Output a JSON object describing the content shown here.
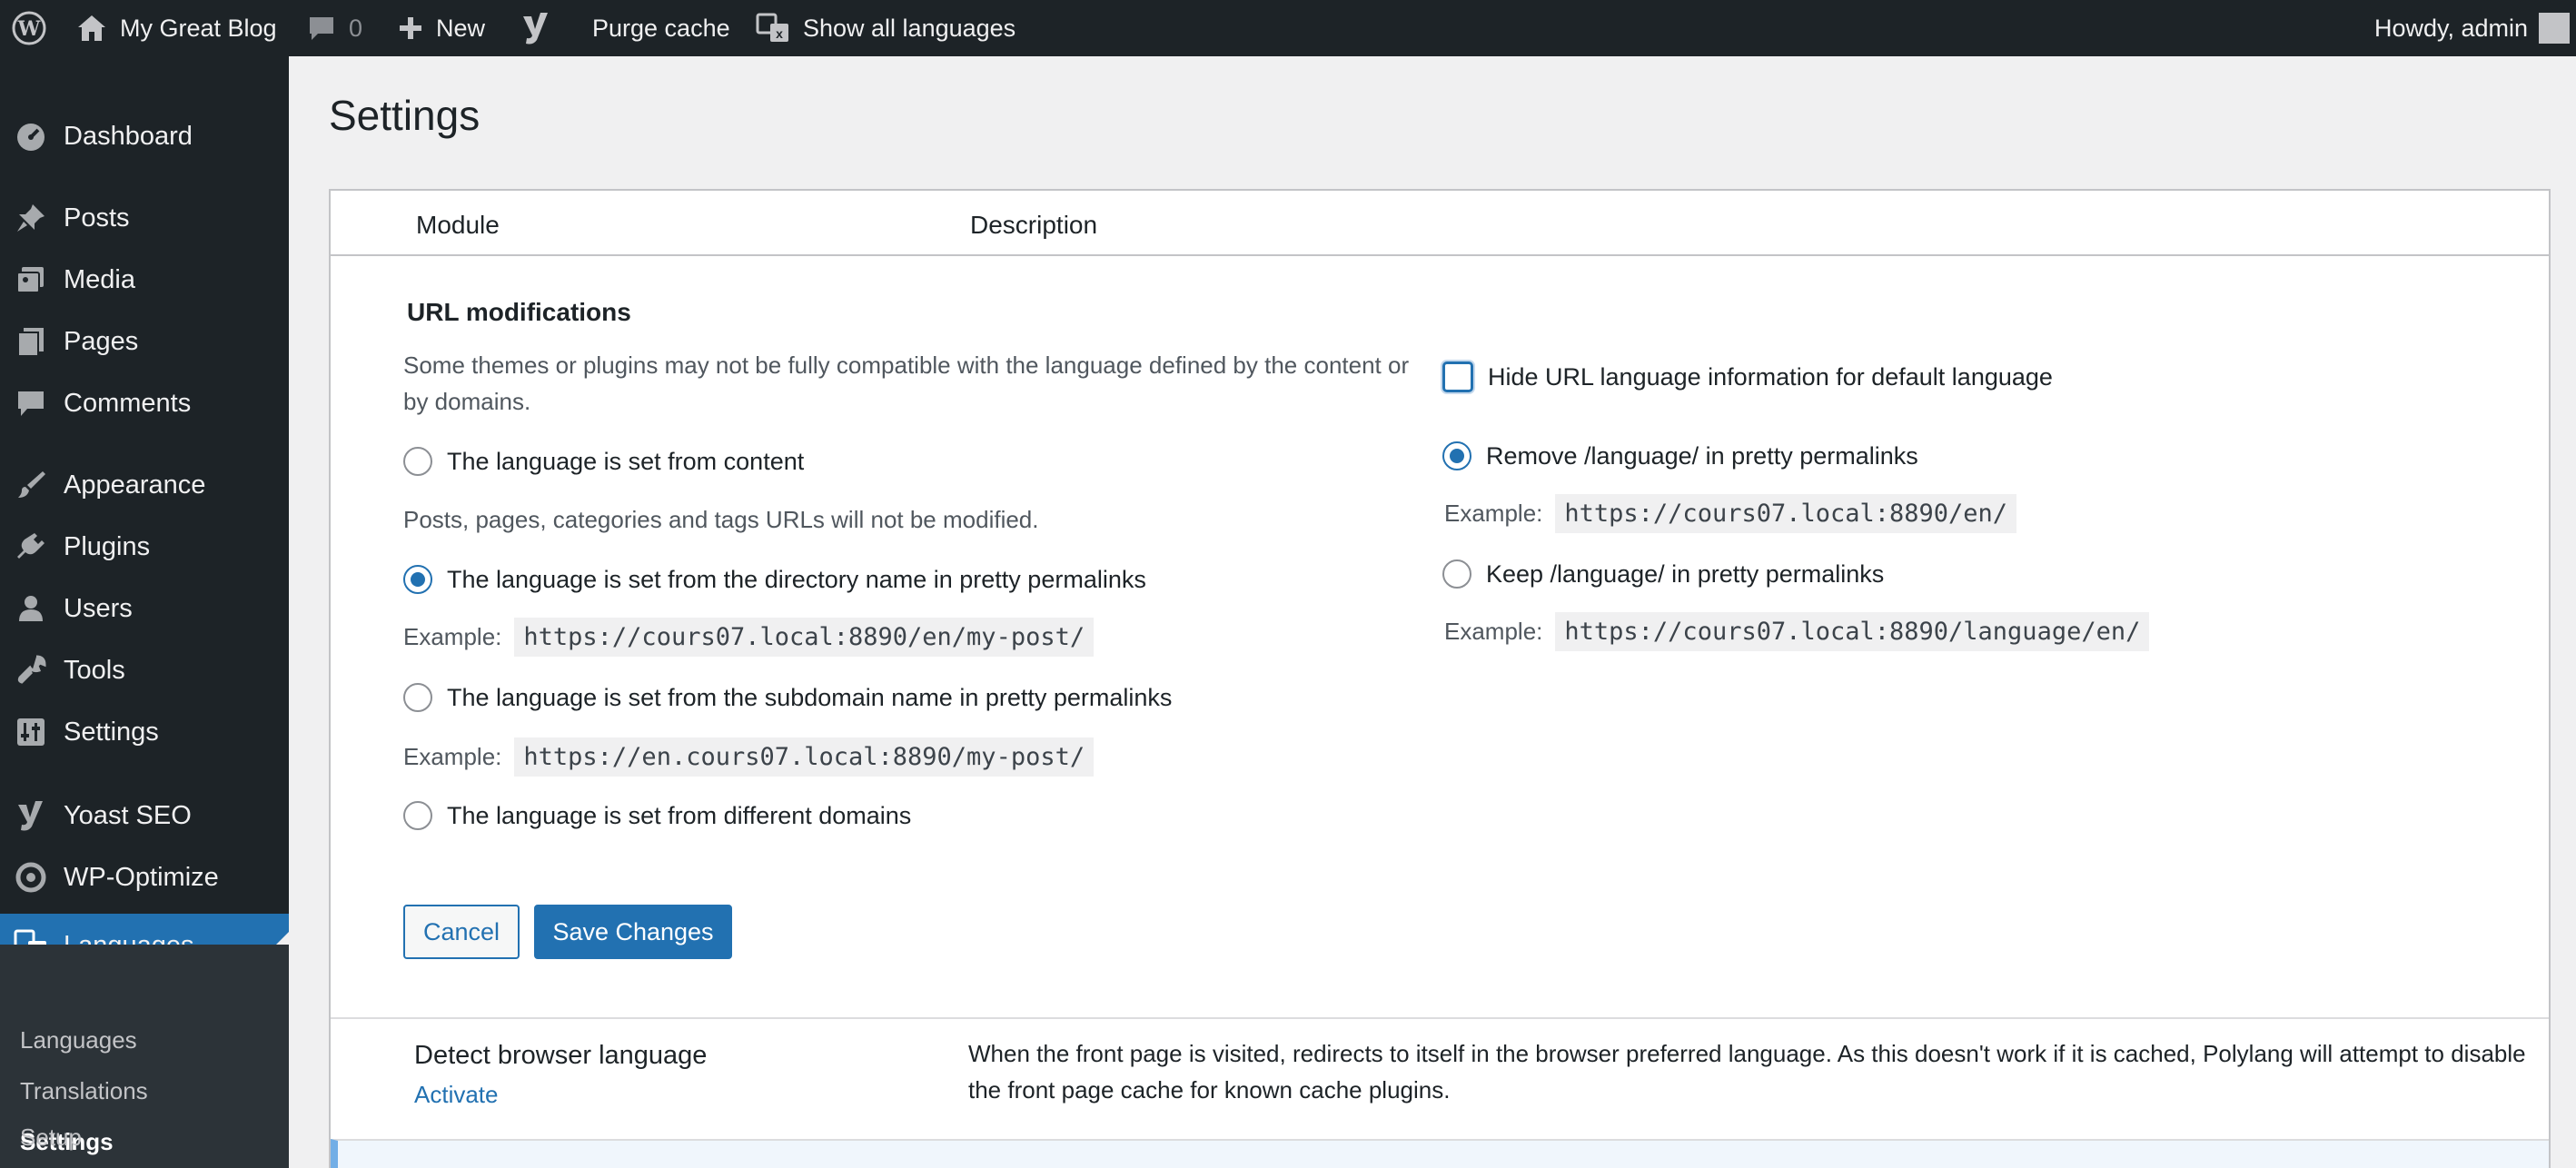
{
  "admin_bar": {
    "site_name": "My Great Blog",
    "comments_count": "0",
    "new_label": "New",
    "purge_cache_label": "Purge cache",
    "show_all_languages_label": "Show all languages",
    "howdy_label": "Howdy, admin"
  },
  "sidebar": {
    "items": [
      {
        "label": "Dashboard",
        "icon": "dashboard-icon"
      },
      {
        "label": "Posts",
        "icon": "pin-icon"
      },
      {
        "label": "Media",
        "icon": "media-icon"
      },
      {
        "label": "Pages",
        "icon": "pages-icon"
      },
      {
        "label": "Comments",
        "icon": "comment-icon"
      },
      {
        "label": "Appearance",
        "icon": "brush-icon"
      },
      {
        "label": "Plugins",
        "icon": "plugin-icon"
      },
      {
        "label": "Users",
        "icon": "user-icon"
      },
      {
        "label": "Tools",
        "icon": "wrench-icon"
      },
      {
        "label": "Settings",
        "icon": "settings-icon"
      },
      {
        "label": "Yoast SEO",
        "icon": "yoast-icon"
      },
      {
        "label": "WP-Optimize",
        "icon": "optimize-icon"
      },
      {
        "label": "Languages",
        "icon": "translate-icon"
      }
    ],
    "submenu": [
      {
        "label": "Languages"
      },
      {
        "label": "Translations"
      },
      {
        "label": "Settings"
      },
      {
        "label": "Setup"
      }
    ],
    "accent_color": "#2271b1"
  },
  "page": {
    "title": "Settings",
    "columns": {
      "module": "Module",
      "description": "Description"
    }
  },
  "url_modifications": {
    "title": "URL modifications",
    "intro": "Some themes or plugins may not be fully compatible with the language defined by the content or by domains.",
    "options": [
      {
        "label": "The language is set from content",
        "checked": false
      },
      {
        "label": "The language is set from the directory name in pretty permalinks",
        "checked": true
      },
      {
        "label": "The language is set from the subdomain name in pretty permalinks",
        "checked": false
      },
      {
        "label": "The language is set from different domains",
        "checked": false
      }
    ],
    "content_note": "Posts, pages, categories and tags URLs will not be modified.",
    "example_label": "Example:",
    "directory_example": "https://cours07.local:8890/en/my-post/",
    "subdomain_example": "https://en.cours07.local:8890/my-post/",
    "hide_default": {
      "label": "Hide URL language information for default language",
      "checked": false
    },
    "pretty_options": [
      {
        "label": "Remove /language/ in pretty permalinks",
        "checked": true,
        "example": "https://cours07.local:8890/en/"
      },
      {
        "label": "Keep /language/ in pretty permalinks",
        "checked": false,
        "example": "https://cours07.local:8890/language/en/"
      }
    ],
    "cancel_label": "Cancel",
    "save_label": "Save Changes"
  },
  "detect_browser": {
    "name": "Detect browser language",
    "action": "Activate",
    "description": "When the front page is visited, redirects to itself in the browser preferred language. As this doesn't work if it is cached, Polylang will attempt to disable the front page cache for known cache plugins."
  }
}
